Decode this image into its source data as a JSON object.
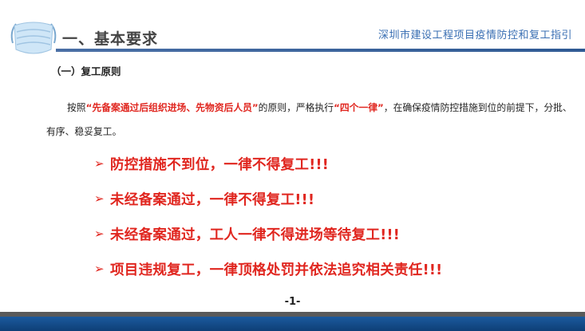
{
  "header": {
    "section_title": "一、基本要求",
    "guide_title": "深圳市建设工程项目疫情防控和复工指引"
  },
  "subheading": "（一）复工原则",
  "paragraph": {
    "part1": "按照",
    "highlight1": "“先备案通过后组织进场、先物资后人员”",
    "part2": "的原则，严格执行",
    "highlight2": "“四个一律”",
    "part3": "，在确保疫情防控措施到位的前提下，分批、有序、稳妥复工。"
  },
  "bullets": [
    {
      "arrow": "➢",
      "text": "防控措施不到位，一律不得复工!!!"
    },
    {
      "arrow": "➢",
      "text": "未经备案通过，一律不得复工!!!"
    },
    {
      "arrow": "➢",
      "text": "未经备案通过，工人一律不得进场等待复工!!!"
    },
    {
      "arrow": "➢",
      "text": "项目违规复工，一律顶格处罚并依法追究相关责任!!!"
    }
  ],
  "page_number": "-1-",
  "colors": {
    "accent_red": "#e0261f",
    "brand_blue": "#1b5a9e",
    "header_text_blue": "#3a6fb3"
  },
  "icons": {
    "logo": "face-mask-icon"
  }
}
